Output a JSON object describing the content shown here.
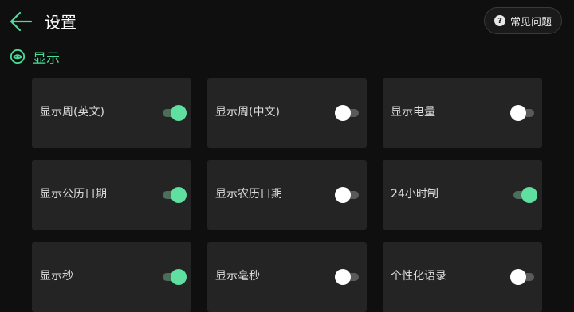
{
  "header": {
    "title": "设置",
    "help_label": "常见问题",
    "help_icon_glyph": "?"
  },
  "section": {
    "title": "显示"
  },
  "colors": {
    "accent": "#4ade9a",
    "background": "#0f0f0f",
    "card": "#242424"
  },
  "settings": [
    {
      "label": "显示周(英文)",
      "enabled": true
    },
    {
      "label": "显示周(中文)",
      "enabled": false
    },
    {
      "label": "显示电量",
      "enabled": false
    },
    {
      "label": "显示公历日期",
      "enabled": true
    },
    {
      "label": "显示农历日期",
      "enabled": false
    },
    {
      "label": "24小时制",
      "enabled": true
    },
    {
      "label": "显示秒",
      "enabled": true
    },
    {
      "label": "显示毫秒",
      "enabled": false
    },
    {
      "label": "个性化语录",
      "enabled": false
    }
  ]
}
